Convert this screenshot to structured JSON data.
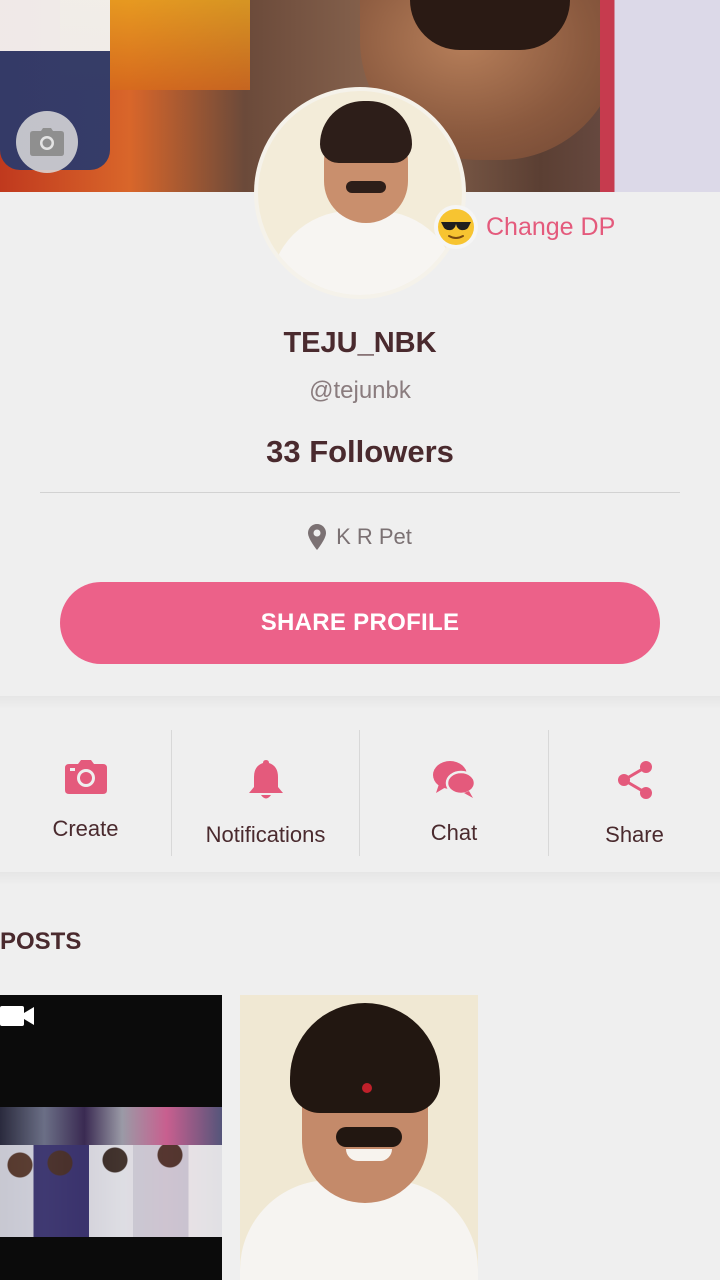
{
  "profile": {
    "change_dp_label": "Change DP",
    "change_dp_emoji": "😎",
    "name": "TEJU_NBK",
    "handle": "@tejunbk",
    "followers": "33 Followers",
    "location": "K R Pet",
    "share_button": "SHARE PROFILE"
  },
  "actions": [
    {
      "label": "Create",
      "icon": "camera-icon"
    },
    {
      "label": "Notifications",
      "icon": "bell-icon"
    },
    {
      "label": "Chat",
      "icon": "chat-icon"
    },
    {
      "label": "Share",
      "icon": "share-icon"
    }
  ],
  "posts": {
    "title": "POSTS"
  },
  "colors": {
    "accent": "#ec6189",
    "text": "#4a2a2e",
    "background": "#efefef"
  }
}
